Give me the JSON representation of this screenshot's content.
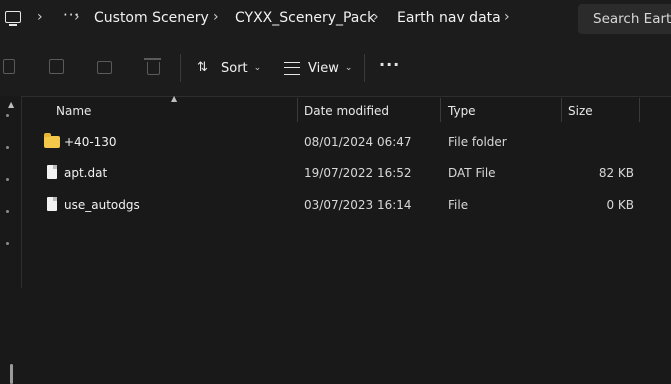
{
  "address_bar": {
    "crumbs": [
      "Custom Scenery",
      "CYXX_Scenery_Pack",
      "Earth nav data"
    ],
    "overflow": "···",
    "search_placeholder": "Search Earth"
  },
  "toolbar": {
    "sort_label": "Sort",
    "view_label": "View",
    "more_label": "···"
  },
  "columns": {
    "name": "Name",
    "date": "Date modified",
    "type": "Type",
    "size": "Size"
  },
  "files": [
    {
      "name": "+40-130",
      "date": "08/01/2024 06:47",
      "type": "File folder",
      "size": "",
      "icon": "folder-icon"
    },
    {
      "name": "apt.dat",
      "date": "19/07/2022 16:52",
      "type": "DAT File",
      "size": "82 KB",
      "icon": "file-icon"
    },
    {
      "name": "use_autodgs",
      "date": "03/07/2023 16:14",
      "type": "File",
      "size": "0 KB",
      "icon": "file-icon"
    }
  ],
  "colors": {
    "background": "#191919",
    "folder": "#f4c74b"
  }
}
